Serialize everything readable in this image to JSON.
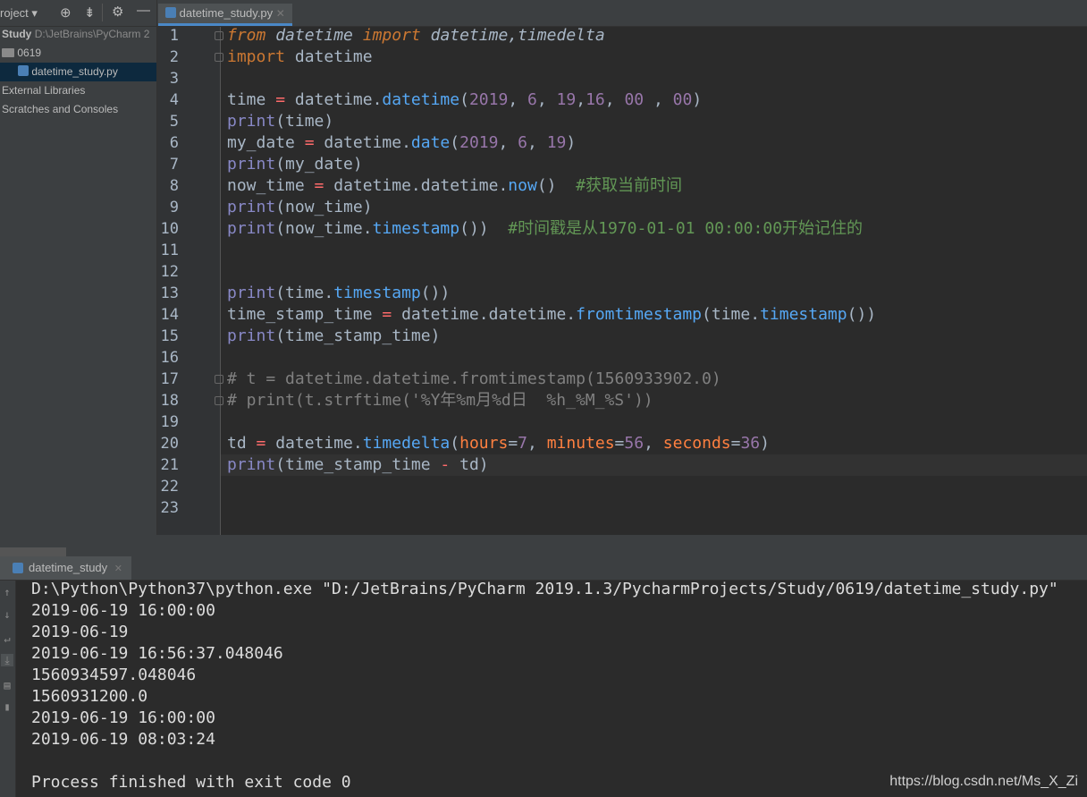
{
  "project_panel": {
    "toolbar_label": "roject ▾",
    "root": {
      "name": "Study",
      "path": "D:\\JetBrains\\PyCharm 2"
    },
    "folder": "0619",
    "file": "datetime_study.py",
    "external_libraries": "External Libraries",
    "scratches": "Scratches and Consoles"
  },
  "editor": {
    "tab_label": "datetime_study.py",
    "line_numbers": [
      "1",
      "2",
      "3",
      "4",
      "5",
      "6",
      "7",
      "8",
      "9",
      "10",
      "11",
      "12",
      "13",
      "14",
      "15",
      "16",
      "17",
      "18",
      "19",
      "20",
      "21",
      "22",
      "23"
    ],
    "lines": [
      "from datetime import datetime,timedelta",
      "import datetime",
      "",
      "time = datetime.datetime(2019, 6, 19,16, 00 , 00)",
      "print(time)",
      "my_date = datetime.date(2019, 6, 19)",
      "print(my_date)",
      "now_time = datetime.datetime.now()  #获取当前时间",
      "print(now_time)",
      "print(now_time.timestamp())  #时间戳是从1970-01-01 00:00:00开始记住的",
      "",
      "",
      "print(time.timestamp())",
      "time_stamp_time = datetime.datetime.fromtimestamp(time.timestamp())",
      "print(time_stamp_time)",
      "",
      "# t = datetime.datetime.fromtimestamp(1560933902.0)",
      "# print(t.strftime('%Y年%m月%d日  %h_%M_%S'))",
      "",
      "td = datetime.timedelta(hours=7, minutes=56, seconds=36)",
      "print(time_stamp_time - td)",
      "",
      ""
    ]
  },
  "run_panel": {
    "tab_label": "datetime_study",
    "output": [
      "D:\\Python\\Python37\\python.exe \"D:/JetBrains/PyCharm 2019.1.3/PycharmProjects/Study/0619/datetime_study.py\"",
      "2019-06-19 16:00:00",
      "2019-06-19",
      "2019-06-19 16:56:37.048046",
      "1560934597.048046",
      "1560931200.0",
      "2019-06-19 16:00:00",
      "2019-06-19 08:03:24",
      "",
      "Process finished with exit code 0"
    ]
  },
  "watermark": "https://blog.csdn.net/Ms_X_Zi",
  "icons": [
    "target-icon",
    "collapse-icon",
    "gear-icon",
    "minimize-icon",
    "python-file-icon",
    "folder-icon",
    "arrow-up-icon",
    "arrow-down-icon",
    "soft-wrap-icon",
    "scroll-end-icon",
    "print-icon",
    "trash-icon",
    "close-icon"
  ],
  "colors": {
    "keyword": "#cc7832",
    "builtin": "#8888c6",
    "method": "#56a8f5",
    "number": "#9876aa",
    "comment": "#629755",
    "operator": "#ff6b6b",
    "param": "#ff8040"
  }
}
